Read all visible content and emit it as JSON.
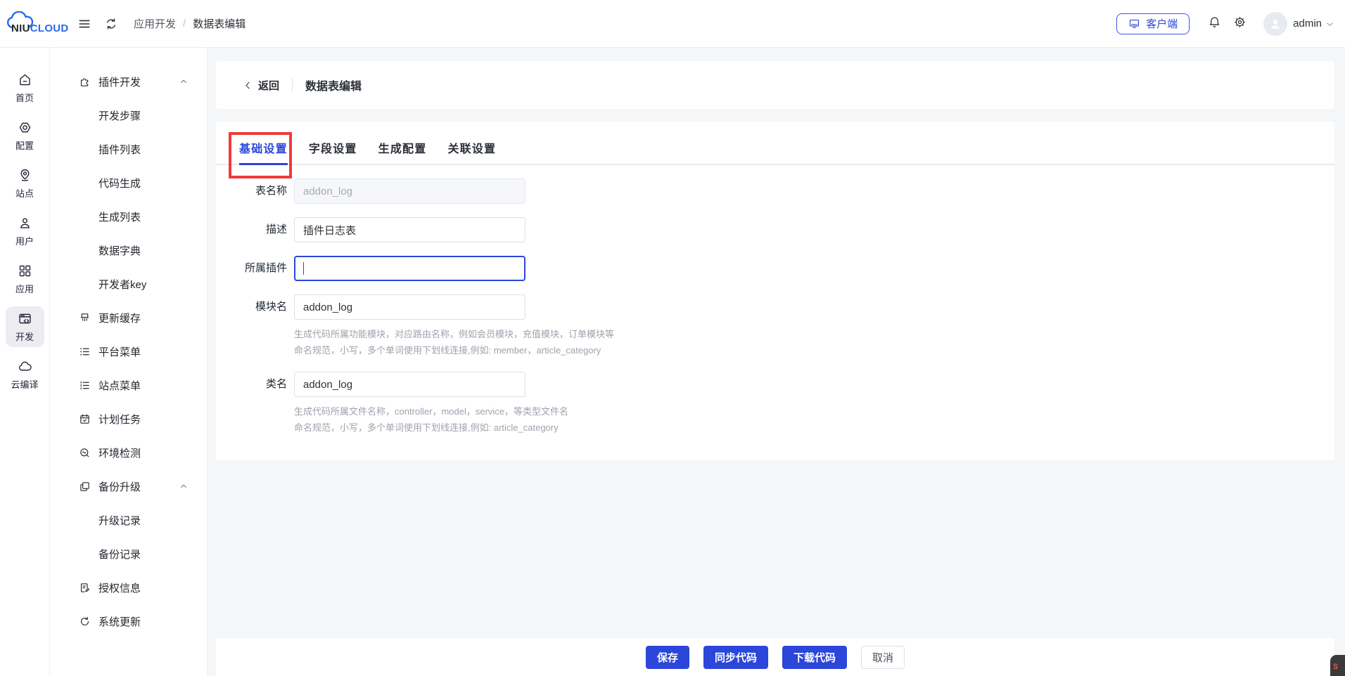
{
  "header": {
    "logo_niu": "NIU",
    "logo_cloud": "CLOUD",
    "breadcrumb": {
      "section": "应用开发",
      "sep": "/",
      "page": "数据表编辑"
    },
    "client_button": "客户端",
    "username": "admin"
  },
  "rail": {
    "items": [
      {
        "label": "首页",
        "icon": "home-icon",
        "active": false
      },
      {
        "label": "配置",
        "icon": "settings-nut-icon",
        "active": false
      },
      {
        "label": "站点",
        "icon": "location-pin-icon",
        "active": false
      },
      {
        "label": "用户",
        "icon": "user-icon",
        "active": false
      },
      {
        "label": "应用",
        "icon": "apps-grid-icon",
        "active": false
      },
      {
        "label": "开发",
        "icon": "dev-window-icon",
        "active": true
      },
      {
        "label": "云编译",
        "icon": "cloud-icon",
        "active": false
      }
    ]
  },
  "sidebar": {
    "items": [
      {
        "label": "插件开发",
        "type": "group",
        "icon": "plugin-icon",
        "expanded": true
      },
      {
        "label": "开发步骤",
        "type": "child"
      },
      {
        "label": "插件列表",
        "type": "child"
      },
      {
        "label": "代码生成",
        "type": "child"
      },
      {
        "label": "生成列表",
        "type": "child"
      },
      {
        "label": "数据字典",
        "type": "child"
      },
      {
        "label": "开发者key",
        "type": "child"
      },
      {
        "label": "更新缓存",
        "type": "item",
        "icon": "brush-icon"
      },
      {
        "label": "平台菜单",
        "type": "item",
        "icon": "list-icon"
      },
      {
        "label": "站点菜单",
        "type": "item",
        "icon": "list-dots-icon"
      },
      {
        "label": "计划任务",
        "type": "item",
        "icon": "calendar-check-icon"
      },
      {
        "label": "环境检测",
        "type": "item",
        "icon": "search-wave-icon"
      },
      {
        "label": "备份升级",
        "type": "group",
        "icon": "copy-icon",
        "expanded": true
      },
      {
        "label": "升级记录",
        "type": "child"
      },
      {
        "label": "备份记录",
        "type": "child"
      },
      {
        "label": "授权信息",
        "type": "item",
        "icon": "document-pen-icon"
      },
      {
        "label": "系统更新",
        "type": "item",
        "icon": "refresh-icon"
      }
    ]
  },
  "page": {
    "back_label": "返回",
    "title": "数据表编辑",
    "tabs": [
      {
        "label": "基础设置",
        "active": true,
        "annotated": true
      },
      {
        "label": "字段设置",
        "active": false
      },
      {
        "label": "生成配置",
        "active": false
      },
      {
        "label": "关联设置",
        "active": false
      }
    ],
    "form": {
      "fields": [
        {
          "label": "表名称",
          "value": "addon_log",
          "state": "disabled"
        },
        {
          "label": "描述",
          "value": "插件日志表",
          "state": "normal"
        },
        {
          "label": "所属插件",
          "value": "",
          "state": "focused"
        },
        {
          "label": "模块名",
          "value": "addon_log",
          "state": "normal",
          "help1": "生成代码所属功能模块，对应路由名称，例如会员模块，充值模块，订单模块等",
          "help2": "命名规范，小写，多个单词使用下划线连接,例如: member，article_category"
        },
        {
          "label": "类名",
          "value": "addon_log",
          "state": "normal",
          "help1": "生成代码所属文件名称，controller，model，service，等类型文件名",
          "help2": "命名规范，小写，多个单词使用下划线连接,例如: article_category"
        }
      ]
    }
  },
  "footer": {
    "buttons": [
      {
        "label": "保存",
        "style": "primary"
      },
      {
        "label": "同步代码",
        "style": "primary"
      },
      {
        "label": "下载代码",
        "style": "primary"
      },
      {
        "label": "取消",
        "style": "plain"
      }
    ]
  },
  "misc": {
    "corner_badge": "s"
  },
  "colors": {
    "primary": "#2b46d9",
    "annotation_red": "#f03b3b",
    "page_background": "#f5f6f8"
  }
}
